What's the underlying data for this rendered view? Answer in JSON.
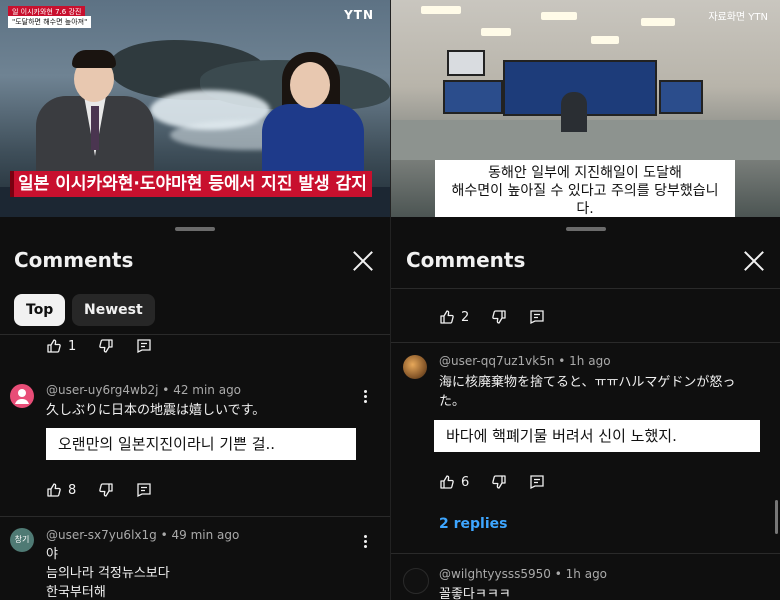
{
  "left": {
    "video": {
      "channel_logo": "YTN",
      "top_ticker_line1": "일 이시카와현 7.6 강진",
      "top_ticker_line2": "\"도달하면 해수면 높아져\"",
      "headline_caption": "일본 이시카와현·도야마현 등에서 지진 발생 감지"
    },
    "sheet": {
      "title": "Comments",
      "tabs": [
        {
          "label": "Top",
          "active": true
        },
        {
          "label": "Newest",
          "active": false
        }
      ]
    },
    "partial_actions": {
      "likes": "1"
    },
    "comments": [
      {
        "author": "@user-uy6rg4wb2j",
        "time": "42 min ago",
        "text": "久しぶりに日本の地震は嬉しいです。",
        "translation_overlay": "오랜만의 일본지진이라니 기쁜 걸..",
        "likes": "8",
        "avatar_color": "#e84d77"
      },
      {
        "author": "@user-sx7yu6lx1g",
        "time": "49 min ago",
        "avatar_label": "창기",
        "text_lines": [
          "야",
          "늠의나라 걱정뉴스보다",
          "한국부터해"
        ],
        "avatar_color": "#4f7a74"
      }
    ]
  },
  "right": {
    "video": {
      "channel_logo": "자료화면 YTN",
      "caption_line1": "동해안 일부에 지진해일이 도달해",
      "caption_line2": "해수면이 높아질 수 있다고 주의를 당부했습니다."
    },
    "sheet": {
      "title": "Comments"
    },
    "partial_actions": {
      "likes": "2"
    },
    "comments": [
      {
        "author": "@user-qq7uz1vk5n",
        "time": "1h ago",
        "text_lines": [
          "海に核廃棄物を捨てると、ㅠㅠハルマゲドンが怒っ",
          "た。"
        ],
        "translation_overlay": "바다에 핵폐기물 버려서 신이 노했지.",
        "likes": "6",
        "replies": "2 replies",
        "avatar_color": "#8a5a2b"
      },
      {
        "author": "@wilghtyysss5950",
        "time": "1h ago",
        "text": "꼴좋다ㅋㅋㅋ",
        "avatar_color": "#111111"
      }
    ]
  },
  "icons": [
    "like-icon",
    "dislike-icon",
    "reply-icon",
    "close-icon",
    "more-options-icon"
  ]
}
